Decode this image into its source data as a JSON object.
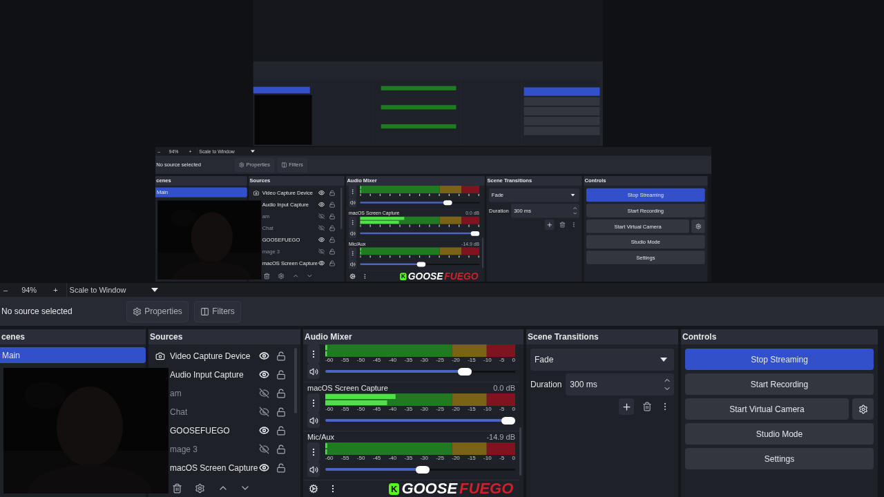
{
  "window": {
    "preview": {
      "window": {
        "preview": {
          "kind": "screen-drawing"
        },
        "toolbar": {
          "zoom_out": "–",
          "zoom": "94%",
          "zoom_in": "+",
          "scale_mode": "Scale to Window"
        },
        "source_bar": {
          "status": "No source selected",
          "properties": "Properties",
          "filters": "Filters"
        },
        "scenes": {
          "title": "cenes",
          "items": [
            {
              "name": "Main",
              "selected": true
            }
          ]
        },
        "sources": {
          "title": "Sources",
          "items": [
            {
              "name": "Video Capture Device",
              "kind": "camera",
              "visible": true
            },
            {
              "name": "Audio Input Capture",
              "kind": "plain",
              "visible": true
            },
            {
              "name": "am",
              "kind": "plain",
              "visible": false
            },
            {
              "name": "Chat",
              "kind": "plain",
              "visible": false
            },
            {
              "name": "GOOSEFUEGO",
              "kind": "plain",
              "visible": true
            },
            {
              "name": "mage 3",
              "kind": "plain",
              "visible": false
            },
            {
              "name": "macOS Screen Capture",
              "kind": "plain",
              "visible": true
            }
          ]
        },
        "mixer": {
          "title": "Audio Mixer",
          "channels": [
            {
              "meter": {
                "level": 0.01
              },
              "volume": {
                "level": 0.77
              }
            },
            {
              "name": "macOS Screen Capture",
              "reading": "0.0 dB",
              "meter": {
                "level": 0.37
              },
              "volume": {
                "level": 1
              }
            },
            {
              "name": "Mic/Aux",
              "reading": "-14.9 dB",
              "meter": {
                "level": 0.01
              },
              "volume": {
                "level": 0.55
              }
            }
          ],
          "logo": {
            "badge": "K",
            "first": "GOOSE",
            "second": "FUEGO"
          }
        },
        "transitions": {
          "title": "Scene Transitions",
          "transition": "Fade",
          "duration_label": "Duration",
          "duration": "300 ms"
        },
        "controls": {
          "title": "Controls",
          "buttons": [
            {
              "label": "Stop Streaming",
              "active": true
            },
            {
              "label": "Start Recording",
              "active": false
            },
            {
              "label": "Start Virtual Camera",
              "active": false,
              "kind": "with-settings"
            },
            {
              "label": "Studio Mode",
              "active": false
            },
            {
              "label": "Settings",
              "active": false
            }
          ]
        }
      }
    },
    "toolbar": {
      "zoom_out": "–",
      "zoom": "94%",
      "zoom_in": "+",
      "scale_mode": "Scale to Window"
    },
    "source_bar": {
      "status": "No source selected",
      "properties": "Properties",
      "filters": "Filters"
    },
    "scenes": {
      "title": "cenes",
      "items": [
        {
          "name": "Main",
          "selected": true
        }
      ]
    },
    "sources": {
      "title": "Sources",
      "items": [
        {
          "name": "Video Capture Device",
          "kind": "camera",
          "visible": true
        },
        {
          "name": "Audio Input Capture",
          "kind": "plain",
          "visible": true
        },
        {
          "name": "am",
          "kind": "plain",
          "visible": false
        },
        {
          "name": "Chat",
          "kind": "plain",
          "visible": false
        },
        {
          "name": "GOOSEFUEGO",
          "kind": "plain",
          "visible": true
        },
        {
          "name": "mage 3",
          "kind": "plain",
          "visible": false
        },
        {
          "name": "macOS Screen Capture",
          "kind": "plain",
          "visible": true
        }
      ]
    },
    "mixer": {
      "title": "Audio Mixer",
      "channels": [
        {
          "scale": [
            "-60",
            "-55",
            "-50",
            "-45",
            "-40",
            "-35",
            "-30",
            "-25",
            "-20",
            "-15",
            "-10",
            "-5",
            "0"
          ],
          "meter": {
            "level": 0.01
          },
          "volume": {
            "level": 0.77
          }
        },
        {
          "name": "macOS Screen Capture",
          "reading": "0.0 dB",
          "scale": [
            "-60",
            "-55",
            "-50",
            "-45",
            "-40",
            "-35",
            "-30",
            "-25",
            "-20",
            "-15",
            "-10",
            "-5",
            "0"
          ],
          "meter": {
            "level": 0.37
          },
          "volume": {
            "level": 1
          }
        },
        {
          "name": "Mic/Aux",
          "reading": "-14.9 dB",
          "scale": [
            "-60",
            "-55",
            "-50",
            "-45",
            "-40",
            "-35",
            "-30",
            "-25",
            "-20",
            "-15",
            "-10",
            "-5",
            "0"
          ],
          "meter": {
            "level": 0.01
          },
          "volume": {
            "level": 0.55
          }
        }
      ],
      "logo": {
        "badge": "K",
        "first": "GOOSE",
        "second": "FUEGO"
      }
    },
    "transitions": {
      "title": "Scene Transitions",
      "transition": "Fade",
      "duration_label": "Duration",
      "duration": "300 ms"
    },
    "controls": {
      "title": "Controls",
      "buttons": [
        {
          "label": "Stop Streaming",
          "active": true
        },
        {
          "label": "Start Recording",
          "active": false
        },
        {
          "label": "Start Virtual Camera",
          "active": false,
          "kind": "with-settings"
        },
        {
          "label": "Studio Mode",
          "active": false
        },
        {
          "label": "Settings",
          "active": false
        }
      ]
    }
  }
}
